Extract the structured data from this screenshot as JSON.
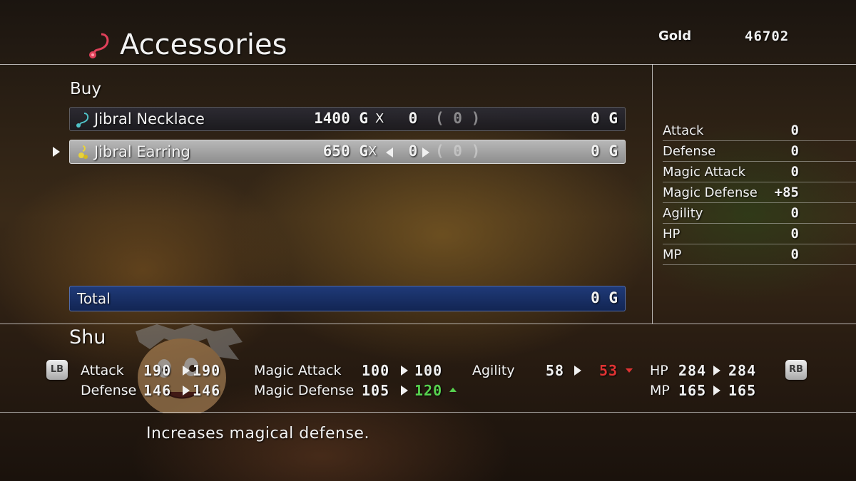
{
  "header": {
    "title": "Accessories",
    "title_icon": "necklace-icon",
    "gold_label": "Gold",
    "gold_value": "46702"
  },
  "shop": {
    "mode_label": "Buy",
    "items": [
      {
        "name": "Jibral Necklace",
        "icon": "necklace-icon",
        "icon_color": "#4fc3c8",
        "price": "1400 G",
        "x": "X",
        "quantity": "0",
        "owned": "( 0 )",
        "line_total": "0 G",
        "selected": false
      },
      {
        "name": "Jibral Earring",
        "icon": "earring-icon",
        "icon_color": "#e8d23a",
        "price": "650 G",
        "x": "X",
        "quantity": "0",
        "owned": "( 0 )",
        "line_total": "0 G",
        "selected": true
      }
    ],
    "total_label": "Total",
    "total_value": "0 G"
  },
  "stat_changes": [
    {
      "label": "Attack",
      "value": "0"
    },
    {
      "label": "Defense",
      "value": "0"
    },
    {
      "label": "Magic Attack",
      "value": "0"
    },
    {
      "label": "Magic Defense",
      "value": "+85"
    },
    {
      "label": "Agility",
      "value": "0"
    },
    {
      "label": "HP",
      "value": "0"
    },
    {
      "label": "MP",
      "value": "0"
    }
  ],
  "character": {
    "name": "Shu",
    "lb_label": "LB",
    "rb_label": "RB",
    "stats": {
      "attack": {
        "label": "Attack",
        "from": "190",
        "to": "190"
      },
      "defense": {
        "label": "Defense",
        "from": "146",
        "to": "146"
      },
      "magic_attack": {
        "label": "Magic Attack",
        "from": "100",
        "to": "100"
      },
      "magic_defense": {
        "label": "Magic Defense",
        "from": "105",
        "to": "120",
        "change": "up"
      },
      "agility": {
        "label": "Agility",
        "from": "58",
        "to": "53",
        "change": "down"
      },
      "hp": {
        "label": "HP",
        "from": "284",
        "to": "284"
      },
      "mp": {
        "label": "MP",
        "from": "165",
        "to": "165"
      }
    }
  },
  "description": "Increases magical defense.",
  "colors": {
    "up": "#57d24f",
    "down": "#e03333",
    "total_bar": "#1f3a78"
  }
}
